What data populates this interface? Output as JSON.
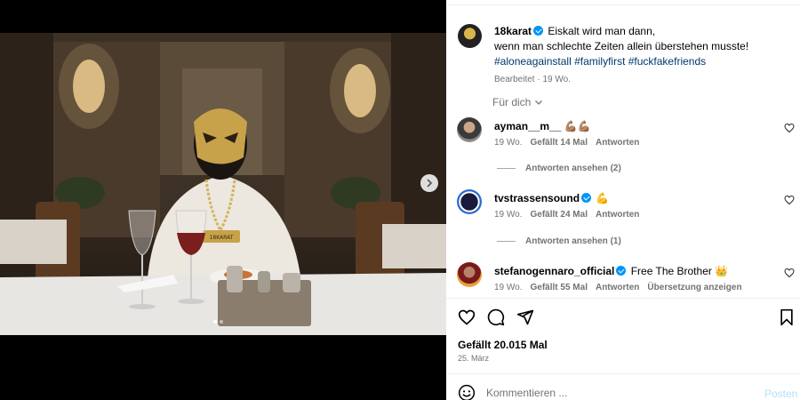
{
  "post": {
    "username": "18karat",
    "caption_line1": "Eiskalt wird man dann,",
    "caption_line2": "wenn man schlechte Zeiten allein überstehen musste!",
    "hashtags": "#aloneagainstall #familyfirst #fuckfakefriends",
    "meta": "Bearbeitet · 19 Wo.",
    "chain_text": "18KARAT"
  },
  "sort_label": "Für dich",
  "comments": [
    {
      "username": "ayman__m__",
      "text": "💪🏽💪🏽",
      "time": "19 Wo.",
      "likes": "Gefällt 14 Mal",
      "reply_label": "Antworten",
      "view_replies": "Antworten ansehen (2)"
    },
    {
      "username": "tvstrassensound",
      "text": "💪",
      "time": "19 Wo.",
      "likes": "Gefällt 24 Mal",
      "reply_label": "Antworten",
      "view_replies": "Antworten ansehen (1)"
    },
    {
      "username": "stefanogennaro_official",
      "text": "Free The Brother 👑",
      "time": "19 Wo.",
      "likes": "Gefällt 55 Mal",
      "reply_label": "Antworten",
      "translate_label": "Übersetzung anzeigen"
    }
  ],
  "likes_total": "Gefällt 20.015 Mal",
  "post_date": "25. März",
  "comment_placeholder": "Kommentieren ...",
  "post_button": "Posten",
  "colors": {
    "link": "#00376b",
    "verified": "#0095f6",
    "muted": "#737373",
    "post_button": "#b2dffc"
  },
  "icons": [
    "heart-icon",
    "comment-icon",
    "share-icon",
    "bookmark-icon",
    "emoji-icon",
    "chevron-down-icon",
    "chevron-right-icon",
    "verified-icon"
  ]
}
